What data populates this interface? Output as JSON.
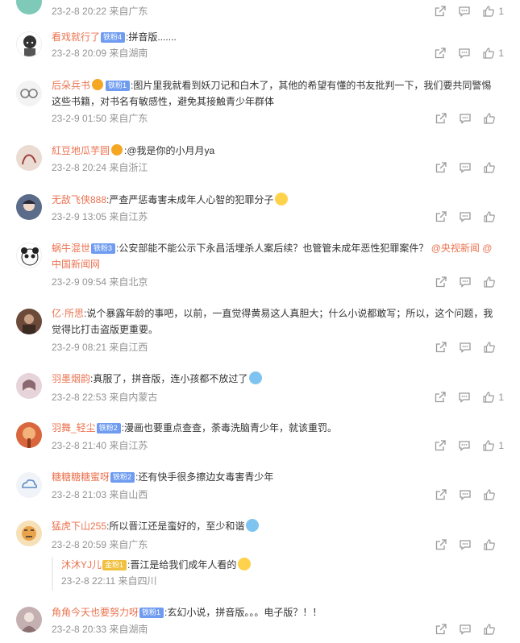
{
  "comments": [
    {
      "date": "23-2-8 20:22",
      "location": "来自广东",
      "likes": "1",
      "avatar_color": "#7fc9b8"
    },
    {
      "user": "看戏就行了",
      "badge": "铁粉4",
      "text": ":拼音版.......",
      "date": "23-2-8 20:09",
      "location": "来自湖南",
      "likes": "1",
      "avatar_color": "#444"
    },
    {
      "user": "后朵兵书",
      "badge": "铁粉1",
      "text": ":图片里我就看到妖刀记和白木了，其他的希望有懂的书友批判一下，我们要共同警惕这些书籍，对书名有敏感性，避免其接触青少年群体",
      "date": "23-2-9 01:50",
      "location": "来自广东",
      "likes": "",
      "avatar_color": "#ccc"
    },
    {
      "user": "紅豆地瓜芋圆",
      "text": ":@我是你的小月月ya",
      "date": "23-2-8 20:24",
      "location": "来自浙江",
      "likes": "",
      "avatar_color": "#d8c3b5"
    },
    {
      "user": "无敌飞侠888",
      "text": ":严查严惩毒害未成年人心智的犯罪分子",
      "date": "23-2-9 13:05",
      "location": "来自江苏",
      "likes": "",
      "avatar_color": "#5b6b8a"
    },
    {
      "user": "蜗牛混世",
      "badge": "铁粉3",
      "text": ":公安部能不能公示下永昌活埋杀人案后续？也管管未成年恶性犯罪案件？",
      "mentions": "@央视新闻 @中国新闻网",
      "date": "23-2-9 09:54",
      "location": "来自北京",
      "likes": "",
      "avatar_color": "#222"
    },
    {
      "user": "亿·所思",
      "text": ":说个暴露年龄的事吧，以前，一直觉得黄易这人真胆大；什么小说都敢写；所以，这个问题，我觉得比打击盗版更重要。",
      "date": "23-2-9 08:21",
      "location": "来自江西",
      "likes": "",
      "avatar_color": "#6b4a3a"
    },
    {
      "user": "羽墨烟韵",
      "text": ":真服了，拼音版，连小孩都不放过了",
      "date": "23-2-8 22:53",
      "location": "来自内蒙古",
      "likes": "1",
      "avatar_color": "#c9a8b0"
    },
    {
      "user": "羽舞_轻尘",
      "badge": "铁粉2",
      "text": ":漫画也要重点查查，荼毒洗脑青少年，就该重罚。",
      "date": "23-2-8 21:40",
      "location": "来自江苏",
      "likes": "1",
      "avatar_color": "#d9663d"
    },
    {
      "user": "糖糖糖糖蜜呀",
      "badge": "铁粉2",
      "text": ":还有快手很多擦边女毒害青少年",
      "date": "23-2-8 21:03",
      "location": "来自山西",
      "likes": "",
      "avatar_color": "#e8eef5"
    },
    {
      "user": "猛虎下山255",
      "text": ":所以晋江还是蛮好的，至少和谐",
      "date": "23-2-8 20:59",
      "location": "来自广东",
      "likes": "",
      "avatar_color": "#e9a34a"
    },
    {
      "user": "角角今天也要努力呀",
      "badge": "铁粉1",
      "text": ":玄幻小说，拼音版。。。电子版？！！",
      "date": "23-2-8 20:33",
      "location": "来自湖南",
      "likes": "",
      "avatar_color": "#a88f8f"
    }
  ],
  "reply": {
    "user": "沐沐YJ儿",
    "badge": "金粉1",
    "text": ":晋江是给我们成年人看的",
    "date": "23-2-8 22:11",
    "location": "来自四川"
  },
  "icons": {
    "share": "share-icon",
    "comment": "comment-icon",
    "like": "like-icon"
  },
  "colors": {
    "username": "#eb7350",
    "meta": "#939393",
    "badge": "#6f9cf0"
  }
}
